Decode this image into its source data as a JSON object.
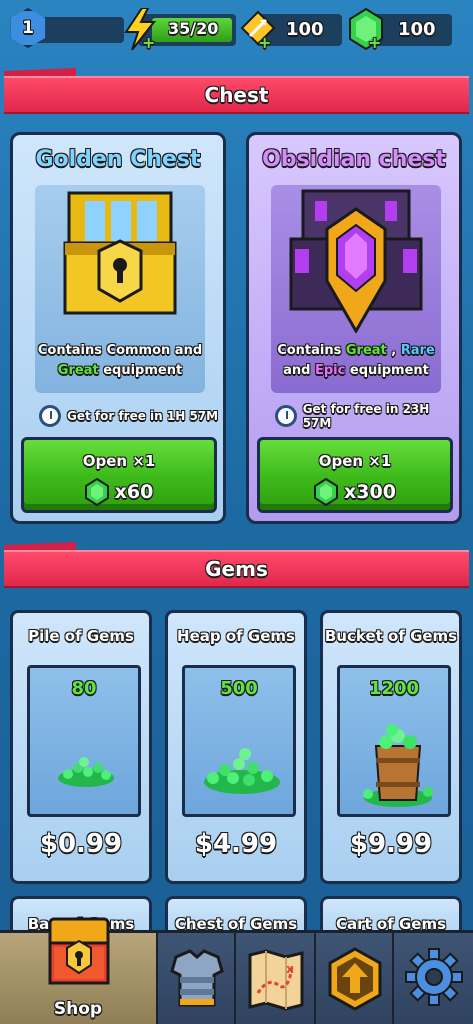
{
  "topbar": {
    "level": "1",
    "energy": "35/20",
    "arrows": "100",
    "gems": "100",
    "plus": "+"
  },
  "chest_section": {
    "title": "Chest",
    "chests": [
      {
        "title": "Golden Chest",
        "desc_parts": [
          "Contains  Common and",
          "Great",
          " equipment"
        ],
        "timer": "Get for free in 1H 57M",
        "button_label": "Open ×1",
        "button_price": "x60"
      },
      {
        "title": "Obsidian chest",
        "desc_parts": [
          "Contains ",
          "Great",
          " , ",
          "Rare",
          "and ",
          "Epic",
          " equipment"
        ],
        "timer": "Get for free in 23H 57M",
        "button_label": "Open ×1",
        "button_price": "x300"
      }
    ]
  },
  "gems_section": {
    "title": "Gems",
    "packs": [
      {
        "title": "Pile of Gems",
        "amount": "80",
        "price": "$0.99"
      },
      {
        "title": "Heap of Gems",
        "amount": "500",
        "price": "$4.99"
      },
      {
        "title": "Bucket of Gems",
        "amount": "1200",
        "price": "$9.99"
      }
    ],
    "next_row": [
      "Bag of Gems",
      "Chest of Gems",
      "Cart of Gems"
    ]
  },
  "bottom_nav": {
    "shop_label": "Shop",
    "tabs": [
      "shop-icon",
      "armor-icon",
      "map-icon",
      "upgrade-icon",
      "settings-icon"
    ]
  },
  "colors": {
    "accent_red": "#e0284c",
    "button_green": "#3fbc1c",
    "gem_green": "#5fe63c"
  }
}
